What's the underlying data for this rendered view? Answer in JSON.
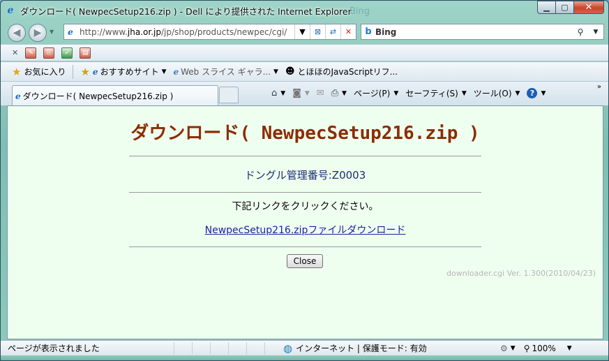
{
  "window": {
    "title": "ダウンロード( NewpecSetup216.zip ) - Dell により提供された Internet Explorer",
    "ghost_text": "Bing",
    "buttons": {
      "minimize": "▁",
      "maximize": "▢",
      "close": "✕"
    }
  },
  "address_bar": {
    "url_prefix": "http://www.",
    "url_domain": "jha.or.jp",
    "url_rest": "/jp/shop/products/newpec/cgi/",
    "search_provider": "Bing"
  },
  "toolbar": {
    "favorites_label": "お気に入り",
    "fav_items": [
      {
        "label": "おすすめサイト"
      },
      {
        "label": "Web スライス ギャラ..."
      },
      {
        "label": "とほほのJavaScriptリフ..."
      }
    ]
  },
  "tab": {
    "title": "ダウンロード( NewpecSetup216.zip )"
  },
  "commands": {
    "page": "ページ(P)",
    "safety": "セーフティ(S)",
    "tools": "ツール(O)",
    "help": "?"
  },
  "content": {
    "heading": "ダウンロード( NewpecSetup216.zip )",
    "dongle_label": "ドングル管理番号:Z0003",
    "instruction": "下記リンクをクリックください。",
    "download_link": "NewpecSetup216.zipファイルダウンロード",
    "close_label": "Close",
    "version": "downloader.cgi Ver. 1.300(2010/04/23)"
  },
  "status": {
    "message": "ページが表示されました",
    "zone": "インターネット | 保護モード: 有効",
    "zoom": "100%"
  },
  "colors": {
    "heading": "#8b2d05",
    "dongle": "#1c2e72",
    "link": "#1a1fa6",
    "page_background": "#efffef"
  }
}
